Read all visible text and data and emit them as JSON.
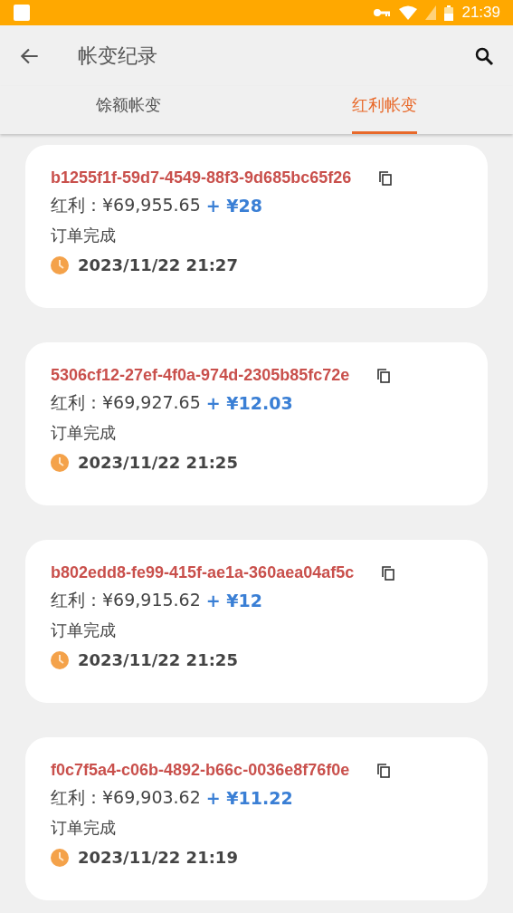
{
  "status_bar": {
    "time": "21:39"
  },
  "app_bar": {
    "title": "帐变纪录"
  },
  "tabs": [
    {
      "label": "馀额帐变",
      "selected": false
    },
    {
      "label": "红利帐变",
      "selected": true
    }
  ],
  "records": [
    {
      "id": "b1255f1f-59d7-4549-88f3-9d685bc65f26",
      "balance": "红利：¥69,955.65",
      "change": "+ ¥28",
      "status": "订单完成",
      "time": "2023/11/22 21:27"
    },
    {
      "id": "5306cf12-27ef-4f0a-974d-2305b85fc72e",
      "balance": "红利：¥69,927.65",
      "change": "+ ¥12.03",
      "status": "订单完成",
      "time": "2023/11/22 21:25"
    },
    {
      "id": "b802edd8-fe99-415f-ae1a-360aea04af5c",
      "balance": "红利：¥69,915.62",
      "change": "+ ¥12",
      "status": "订单完成",
      "time": "2023/11/22 21:25"
    },
    {
      "id": "f0c7f5a4-c06b-4892-b66c-0036e8f76f0e",
      "balance": "红利：¥69,903.62",
      "change": "+ ¥11.22",
      "status": "订单完成",
      "time": "2023/11/22 21:19"
    }
  ]
}
